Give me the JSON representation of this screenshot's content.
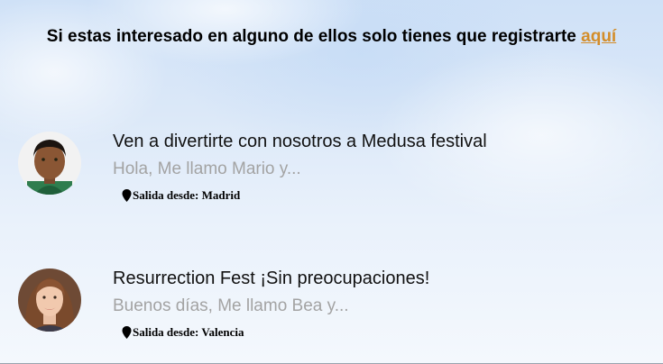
{
  "header": {
    "text": "Si estas interesado en alguno de ellos solo tienes que registrarte",
    "link_label": "aquí",
    "link_color": "#d38d2a"
  },
  "trips": [
    {
      "title": "Ven a divertirte con nosotros a Medusa festival",
      "excerpt": "Hola, Me llamo Mario y...",
      "departure": "Salida desde: Madrid",
      "icon": "map-pin-icon"
    },
    {
      "title": "Resurrection Fest ¡Sin preocupaciones!",
      "excerpt": "Buenos días, Me llamo Bea y...",
      "departure": "Salida desde: Valencia",
      "icon": "map-pin-icon"
    }
  ]
}
